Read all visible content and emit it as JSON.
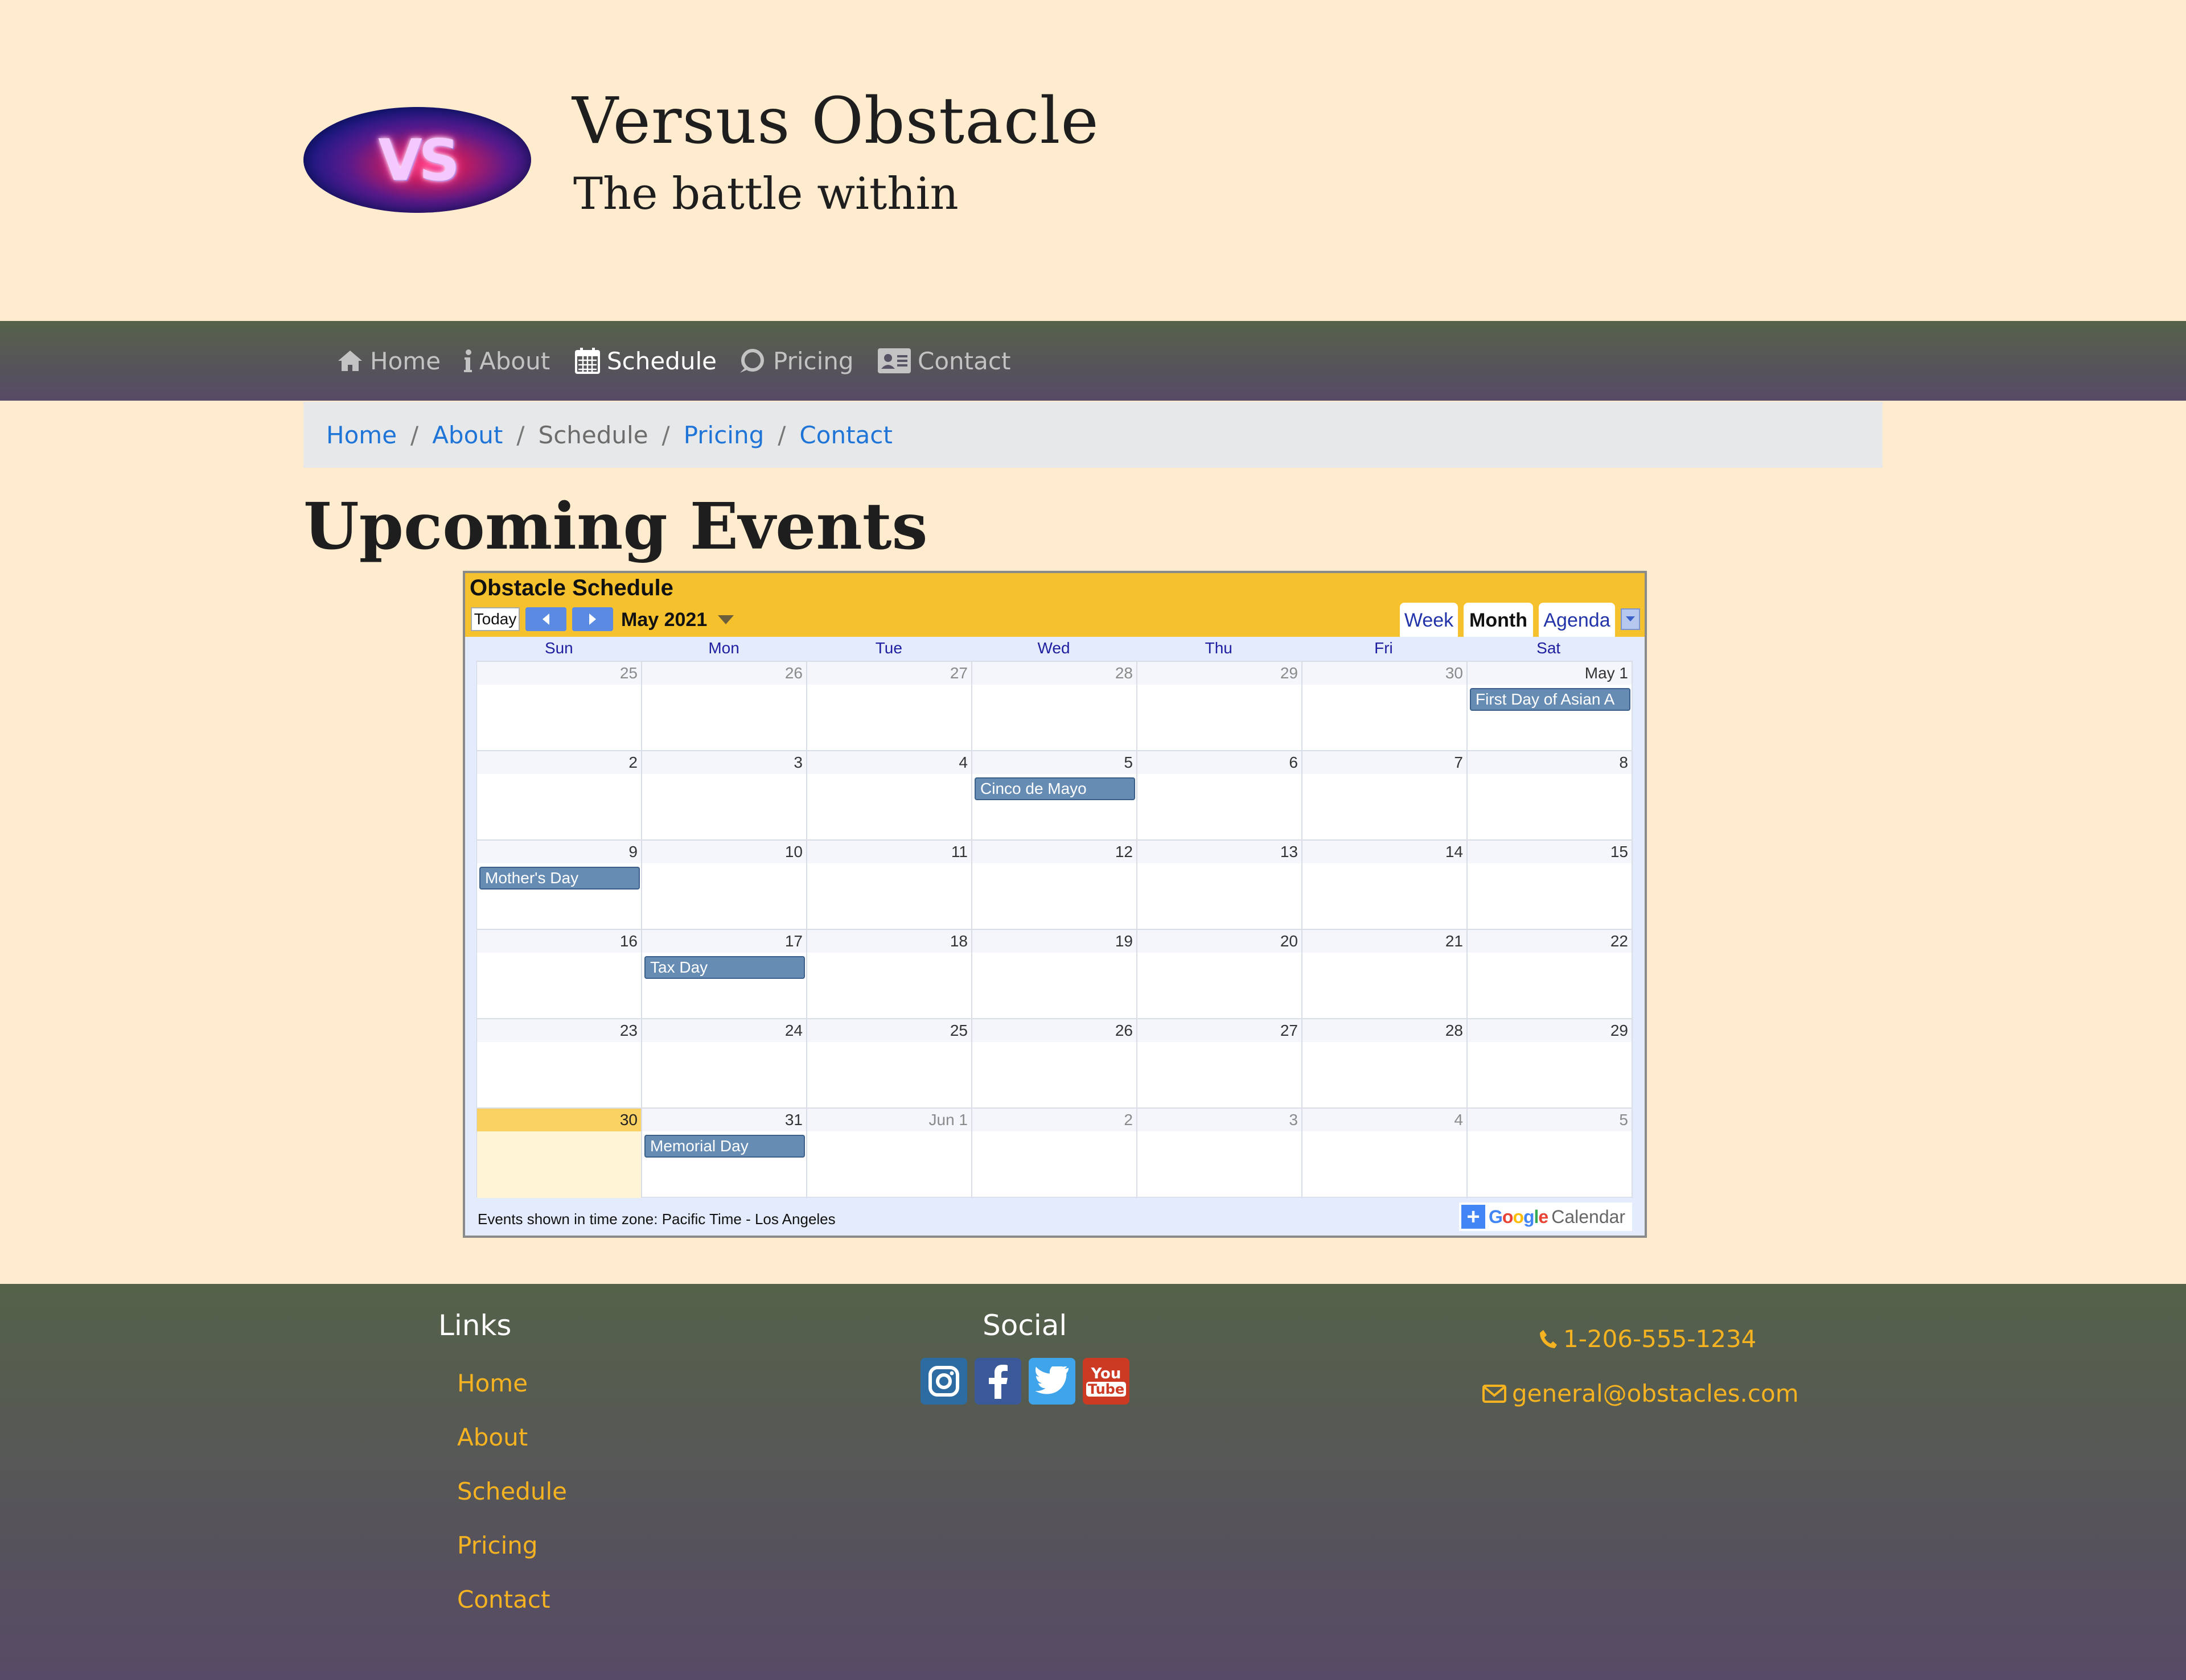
{
  "header": {
    "logo_text": "VS",
    "title": "Versus Obstacle",
    "subtitle": "The battle within"
  },
  "nav": {
    "items": [
      {
        "label": "Home",
        "icon": "home-icon"
      },
      {
        "label": "About",
        "icon": "info-icon"
      },
      {
        "label": "Schedule",
        "icon": "calendar-icon",
        "active": true
      },
      {
        "label": "Pricing",
        "icon": "pricing-icon"
      },
      {
        "label": "Contact",
        "icon": "contact-card-icon"
      }
    ]
  },
  "breadcrumb": {
    "items": [
      "Home",
      "About",
      "Schedule",
      "Pricing",
      "Contact"
    ],
    "separator": "/",
    "current": "Schedule"
  },
  "page": {
    "heading": "Upcoming Events"
  },
  "calendar": {
    "title": "Obstacle Schedule",
    "today_label": "Today",
    "month_label": "May 2021",
    "tabs": [
      "Week",
      "Month",
      "Agenda"
    ],
    "active_tab": "Month",
    "days_of_week": [
      "Sun",
      "Mon",
      "Tue",
      "Wed",
      "Thu",
      "Fri",
      "Sat"
    ],
    "weeks": [
      [
        "25",
        "26",
        "27",
        "28",
        "29",
        "30",
        "May 1"
      ],
      [
        "2",
        "3",
        "4",
        "5",
        "6",
        "7",
        "8"
      ],
      [
        "9",
        "10",
        "11",
        "12",
        "13",
        "14",
        "15"
      ],
      [
        "16",
        "17",
        "18",
        "19",
        "20",
        "21",
        "22"
      ],
      [
        "23",
        "24",
        "25",
        "26",
        "27",
        "28",
        "29"
      ],
      [
        "30",
        "31",
        "Jun 1",
        "2",
        "3",
        "4",
        "5"
      ]
    ],
    "events": {
      "first_day_asian": "First Day of Asian A",
      "cinco_de_mayo": "Cinco de Mayo",
      "mothers_day": "Mother's Day",
      "tax_day": "Tax Day",
      "memorial_day": "Memorial Day"
    },
    "timezone_note": "Events shown in time zone: Pacific Time - Los Angeles",
    "badge_plus": "+",
    "badge_google": "Google",
    "badge_calendar": "Calendar"
  },
  "footer": {
    "links_heading": "Links",
    "links": [
      "Home",
      "About",
      "Schedule",
      "Pricing",
      "Contact"
    ],
    "social_heading": "Social",
    "social": [
      "instagram-icon",
      "facebook-icon",
      "twitter-icon",
      "youtube-icon"
    ],
    "youtube_text_top": "You",
    "youtube_text_bottom": "Tube",
    "phone": "1-206-555-1234",
    "email": "general@obstacles.com"
  },
  "colors": {
    "page_bg": "#ffebcd",
    "nav_gradient_top": "#556249",
    "nav_gradient_bottom": "#574a66",
    "link_blue": "#1f74d7",
    "footer_link": "#f5b321",
    "calendar_bar": "#f5c22e",
    "event_bg": "#668cb3",
    "today_cell": "#fad163"
  }
}
